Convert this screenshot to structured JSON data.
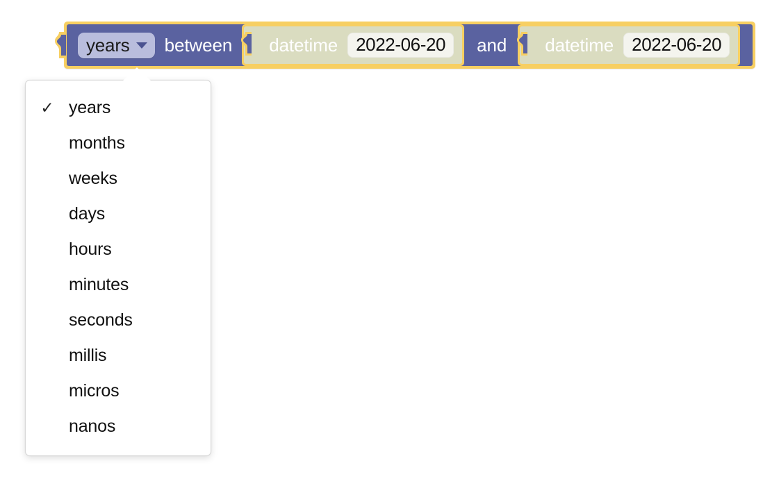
{
  "block": {
    "unit_dropdown": {
      "value": "years",
      "arrow_icon": "chevron-down-icon"
    },
    "between_label": "between",
    "and_label": "and",
    "start": {
      "type_label": "datetime",
      "value": "2022-06-20"
    },
    "end": {
      "type_label": "datetime",
      "value": "2022-06-20"
    }
  },
  "menu": {
    "selected": "years",
    "check_glyph": "✓",
    "items": [
      {
        "label": "years",
        "checked": true
      },
      {
        "label": "months",
        "checked": false
      },
      {
        "label": "weeks",
        "checked": false
      },
      {
        "label": "days",
        "checked": false
      },
      {
        "label": "hours",
        "checked": false
      },
      {
        "label": "minutes",
        "checked": false
      },
      {
        "label": "seconds",
        "checked": false
      },
      {
        "label": "millis",
        "checked": false
      },
      {
        "label": "micros",
        "checked": false
      },
      {
        "label": "nanos",
        "checked": false
      }
    ]
  },
  "colors": {
    "block_fill": "#5a62a0",
    "block_highlight": "#f7cf62",
    "value_block_fill": "#dadcc0",
    "dropdown_field_fill": "#b9bddd",
    "date_field_fill": "#f4f4ee",
    "menu_background": "#ffffff",
    "text_on_block": "#ffffff",
    "text_dark": "#111111"
  }
}
